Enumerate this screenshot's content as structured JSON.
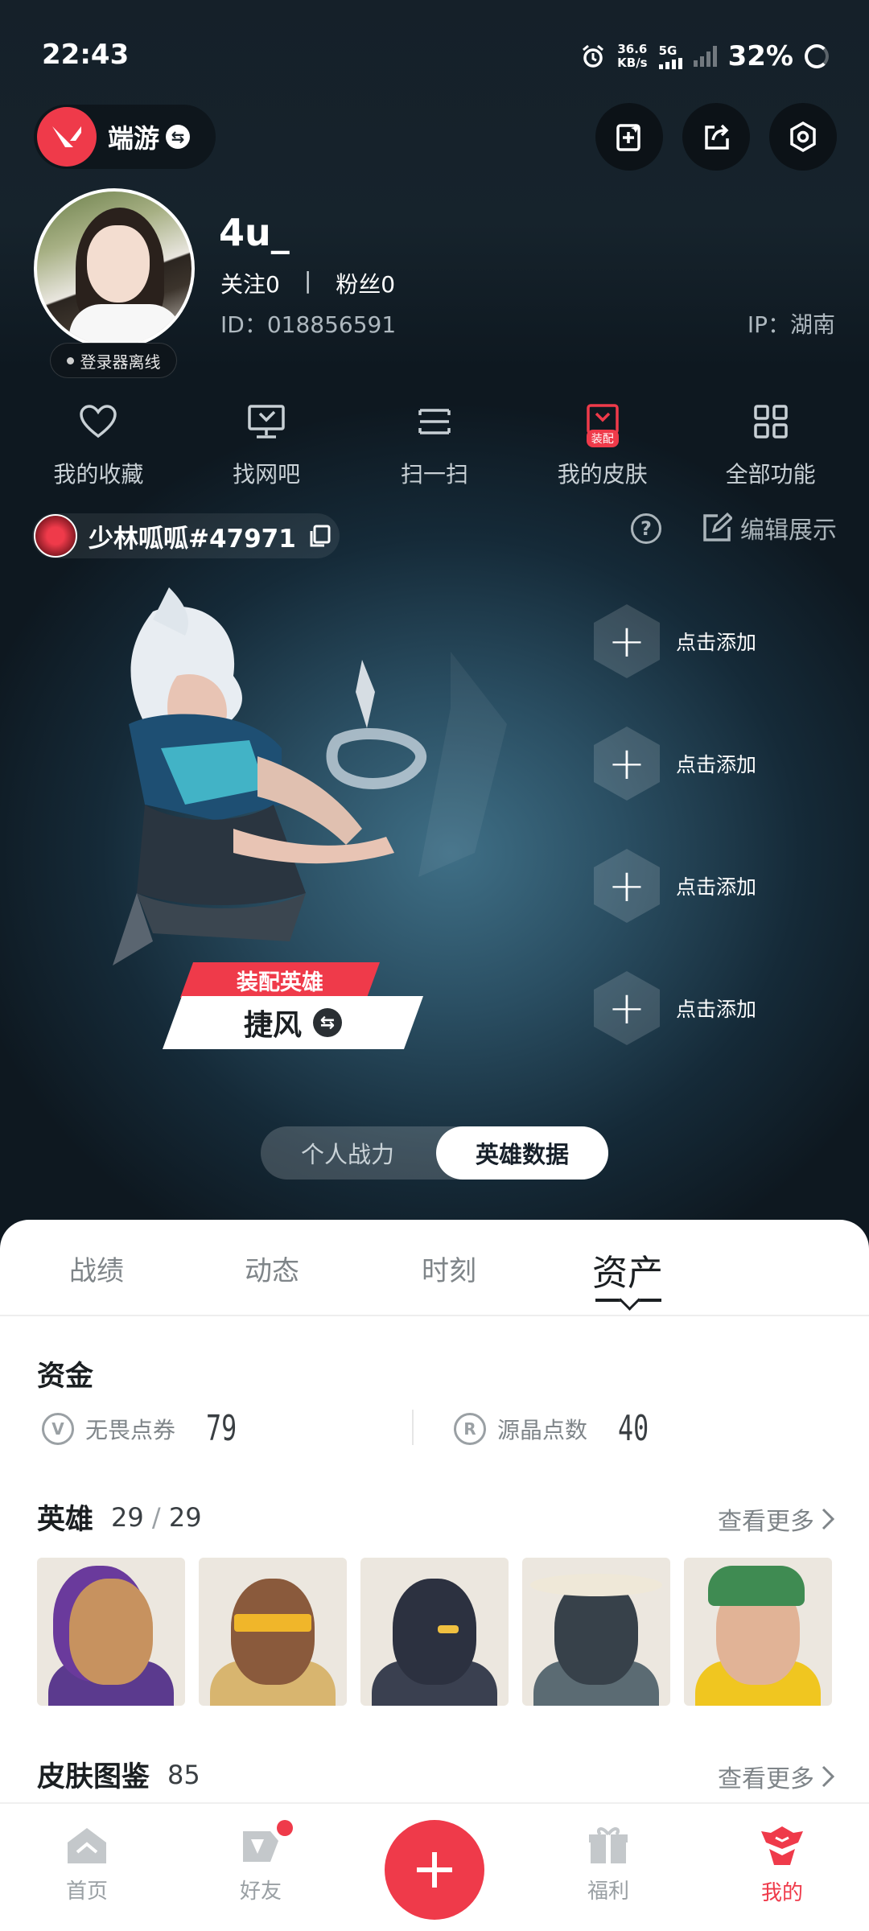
{
  "status_bar": {
    "time": "22:43",
    "net_speed_value": "36.6",
    "net_speed_unit": "KB/s",
    "network": "5G",
    "battery": "32%"
  },
  "header": {
    "game_name": "端游",
    "accent_color": "#ef3a4a"
  },
  "profile": {
    "username": "4u_",
    "following": "关注0",
    "separator": "|",
    "followers": "粉丝0",
    "id": "ID：018856591",
    "ip": "IP：湖南",
    "login_status": "登录器离线"
  },
  "quick_functions": [
    {
      "label": "我的收藏",
      "icon": "heart-icon"
    },
    {
      "label": "找网吧",
      "icon": "monitor-icon"
    },
    {
      "label": "扫一扫",
      "icon": "scan-icon"
    },
    {
      "label": "我的皮肤",
      "icon": "skin-icon",
      "tag": "装配"
    },
    {
      "label": "全部功能",
      "icon": "grid-icon"
    }
  ],
  "player": {
    "name": "少林呱呱#47971",
    "edit_label": "编辑展示",
    "help_glyph": "?"
  },
  "hero_display": {
    "equip_label": "装配英雄",
    "hero_name": "捷风",
    "add_slots": [
      "点击添加",
      "点击添加",
      "点击添加",
      "点击添加"
    ]
  },
  "toggle": {
    "options": [
      "个人战力",
      "英雄数据"
    ],
    "selected": "英雄数据"
  },
  "tabs": {
    "items": [
      "战绩",
      "动态",
      "时刻",
      "资产"
    ],
    "active": "资产"
  },
  "assets": {
    "funds_title": "资金",
    "currencies": [
      {
        "label": "无畏点券",
        "value": "79",
        "icon": "valorant-points-icon"
      },
      {
        "label": "源晶点数",
        "value": "40",
        "icon": "radianite-icon"
      }
    ],
    "heroes_title": "英雄",
    "heroes_owned": "29",
    "heroes_total": "29",
    "heroes_slash": "/",
    "see_more": "查看更多",
    "skins_title": "皮肤图鉴",
    "skins_count": "85"
  },
  "bottom_nav": {
    "items": [
      "首页",
      "好友",
      "福利",
      "我的"
    ],
    "active": "我的"
  }
}
